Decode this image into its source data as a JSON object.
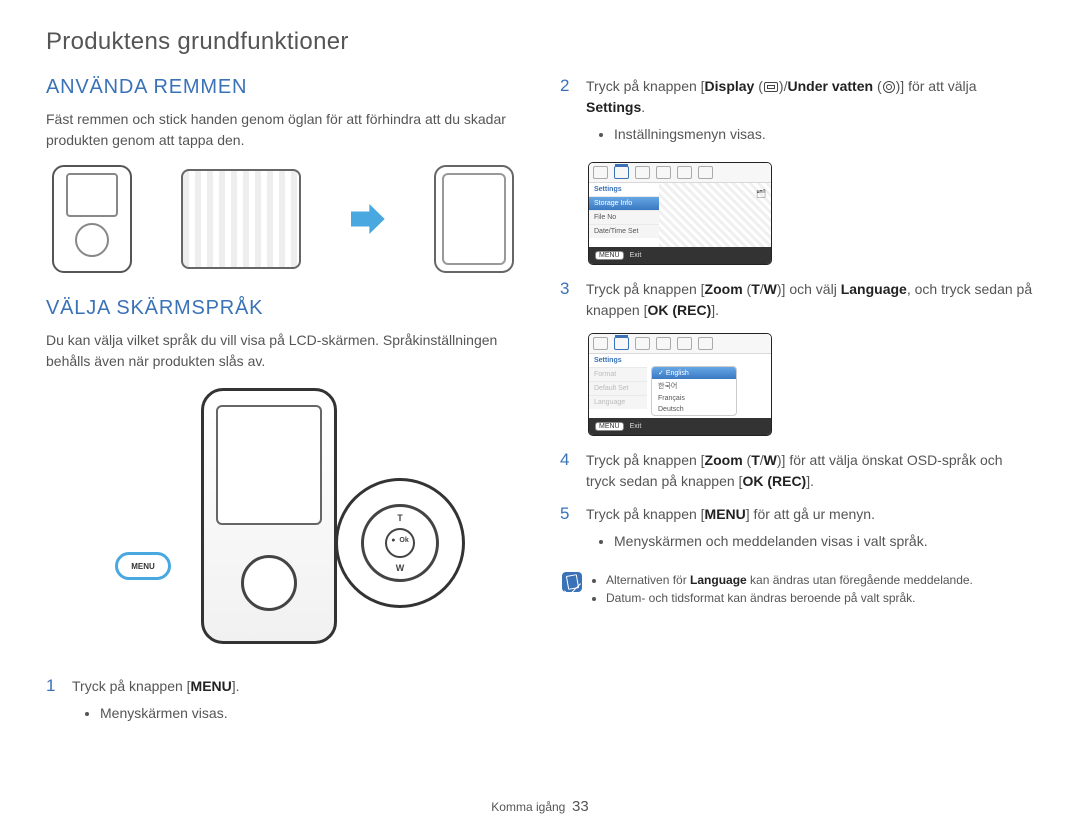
{
  "page": {
    "header": "Produktens grundfunktioner",
    "footer_section": "Komma igång",
    "footer_page": "33"
  },
  "left": {
    "h2_strap": "ANVÄNDA REMMEN",
    "strap_para": "Fäst remmen och stick handen genom öglan för att förhindra att du skadar produkten genom att tappa den.",
    "h2_lang": "VÄLJA SKÄRMSPRÅK",
    "lang_para": "Du kan välja vilket språk du vill visa på LCD-skärmen. Språkinställningen behålls även när produkten slås av.",
    "menu_callout": "MENU",
    "magnify": {
      "t": "T",
      "w": "W",
      "ok": "Ok",
      "rec": "●"
    },
    "step1": {
      "num": "1",
      "text_pre": "Tryck på knappen [",
      "text_bold": "MENU",
      "text_post": "].",
      "bullet": "Menyskärmen visas."
    }
  },
  "right": {
    "step2": {
      "num": "2",
      "p1": "Tryck på knappen [",
      "b1": "Display",
      "p2": " (",
      "p3": ")/",
      "b2": "Under vatten",
      "p4": " (",
      "p5": ")] för att välja ",
      "b3": "Settings",
      "p6": ".",
      "bullet": "Inställningsmenyn visas."
    },
    "lcd1": {
      "tab_label": "Settings",
      "rows": [
        "Storage Info",
        "File No",
        "Date/Time Set"
      ],
      "exit_key": "MENU",
      "exit_label": "Exit"
    },
    "step3": {
      "num": "3",
      "p1": "Tryck på knappen [",
      "b1": "Zoom",
      "p2": " (",
      "b2": "T",
      "p3": "/",
      "b3": "W",
      "p4": ")] och välj ",
      "b4": "Language",
      "p5": ", och tryck sedan på knappen [",
      "b5": "OK (REC)",
      "p6": "]."
    },
    "lcd2": {
      "tab_label": "Settings",
      "left_rows": [
        "Format",
        "Default Set",
        "Language"
      ],
      "lang_options": [
        "English",
        "한국어",
        "Français",
        "Deutsch"
      ],
      "exit_key": "MENU",
      "exit_label": "Exit"
    },
    "step4": {
      "num": "4",
      "p1": "Tryck på knappen [",
      "b1": "Zoom",
      "p2": " (",
      "b2": "T",
      "p3": "/",
      "b3": "W",
      "p4": ")] för att välja önskat OSD-språk och tryck sedan på knappen [",
      "b4": "OK (REC)",
      "p5": "]."
    },
    "step5": {
      "num": "5",
      "p1": "Tryck på knappen [",
      "b1": "MENU",
      "p2": "] för att gå ur menyn.",
      "bullet": "Menyskärmen och meddelanden visas i valt språk."
    },
    "notes": [
      "Alternativen för Language kan ändras utan föregående meddelande.",
      "Datum- och tidsformat kan ändras beroende på valt språk."
    ],
    "notes_bold_word": "Language"
  }
}
